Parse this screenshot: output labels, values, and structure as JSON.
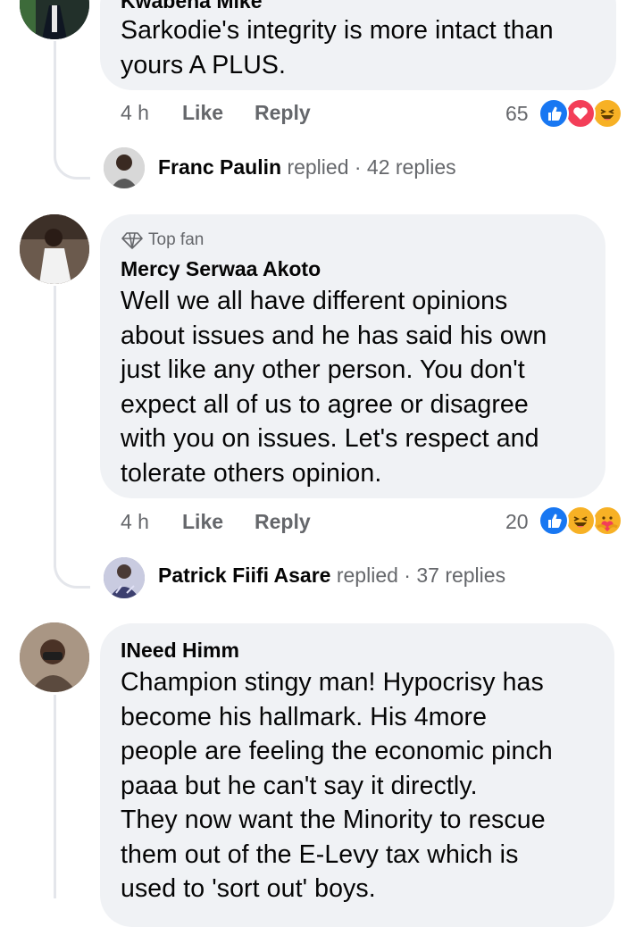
{
  "comments": [
    {
      "author": "Kwabena Mike",
      "text_lines": [
        "Sarkodie's integrity is more intact than",
        "yours A PLUS."
      ],
      "time": "4 h",
      "like_label": "Like",
      "reply_label": "Reply",
      "reaction_count": "65",
      "reactions": [
        "like-icon",
        "love-icon",
        "haha-icon"
      ],
      "reply_author": "Franc Paulin",
      "reply_verb": "replied",
      "reply_count": "· 42 replies"
    },
    {
      "badge": "Top fan",
      "author": "Mercy Serwaa Akoto",
      "text_lines": [
        "Well we all have different opinions",
        "about issues and he has said his own",
        "just like any other person. You don't",
        "expect all of us to agree or disagree",
        "with you on issues. Let's respect  and",
        "tolerate others opinion."
      ],
      "time": "4 h",
      "like_label": "Like",
      "reply_label": "Reply",
      "reaction_count": "20",
      "reactions": [
        "like-icon",
        "haha-icon",
        "care-icon"
      ],
      "reply_author": "Patrick Fiifi Asare",
      "reply_verb": "replied",
      "reply_count": "· 37 replies"
    },
    {
      "author": "INeed Himm",
      "text_lines": [
        "Champion stingy man! Hypocrisy has",
        "become his hallmark. His 4more",
        "people are feeling the economic pinch",
        "paaa but he can't say it directly.",
        "They now want the Minority to rescue",
        "them out of the E-Levy tax which is",
        "used to 'sort out' boys."
      ]
    }
  ],
  "colors": {
    "bubble": "#f0f2f5",
    "meta_text": "#65676b",
    "like_blue": "#1877f2",
    "love_red": "#f33e58",
    "haha_yellow": "#f7b125"
  }
}
